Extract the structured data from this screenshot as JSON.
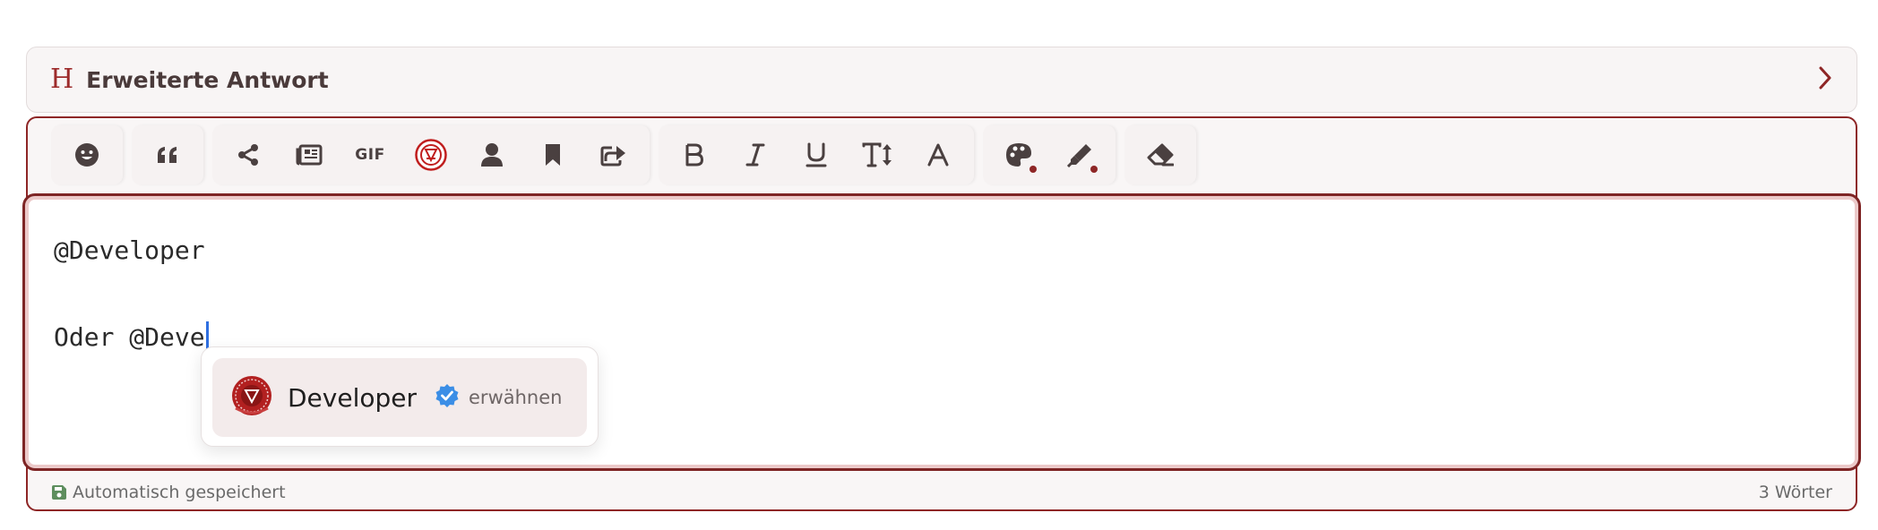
{
  "header": {
    "title": "Erweiterte Antwort",
    "icon": "h-letter-icon",
    "expand_icon": "chevron-right-icon"
  },
  "toolbar": {
    "groups": [
      [
        "emoji-icon"
      ],
      [
        "quote-icon"
      ],
      [
        "share-icon",
        "newspaper-icon",
        "gif-icon",
        "club-logo-icon",
        "user-icon",
        "bookmark-icon",
        "forward-icon"
      ],
      [
        "bold-icon",
        "italic-icon",
        "underline-icon",
        "text-size-icon",
        "font-icon"
      ],
      [
        "palette-icon",
        "highlighter-icon"
      ],
      [
        "eraser-icon"
      ]
    ],
    "gif_label": "GIF"
  },
  "editor": {
    "line1": "@Developer",
    "line2": "Oder @Deve"
  },
  "mention_popup": {
    "name": "Developer",
    "action": "erwähnen",
    "verified": true
  },
  "footer": {
    "autosave": "Automatisch gespeichert",
    "word_count": "3 Wörter"
  },
  "colors": {
    "accent": "#8e2626",
    "caret": "#2f6fe0",
    "verified": "#3b8ee6"
  }
}
